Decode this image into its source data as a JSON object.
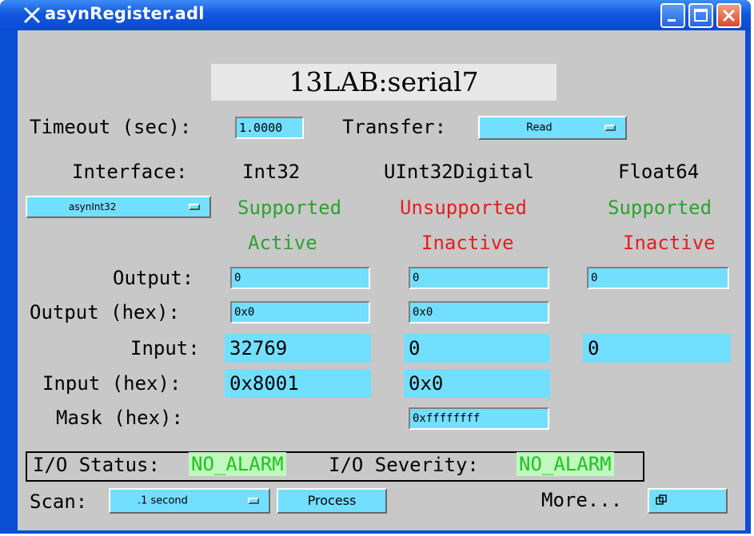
{
  "window": {
    "title": "asynRegister.adl"
  },
  "header": {
    "device": "13LAB:serial7"
  },
  "timeout": {
    "label": "Timeout (sec):",
    "value": "1.0000"
  },
  "transfer": {
    "label": "Transfer:",
    "value": "Read"
  },
  "interface": {
    "label": "Interface:",
    "selected": "asynInt32",
    "columns": [
      {
        "name": "Int32",
        "support": "Supported",
        "state": "Active"
      },
      {
        "name": "UInt32Digital",
        "support": "Unsupported",
        "state": "Inactive"
      },
      {
        "name": "Float64",
        "support": "Supported",
        "state": "Inactive"
      }
    ]
  },
  "rows": {
    "output": {
      "label": "Output:",
      "int32": "0",
      "uint32": "0",
      "float64": "0"
    },
    "output_hex": {
      "label": "Output (hex):",
      "int32": "0x0",
      "uint32": "0x0"
    },
    "input": {
      "label": "Input:",
      "int32": "32769",
      "uint32": "0",
      "float64": "0"
    },
    "input_hex": {
      "label": "Input (hex):",
      "int32": "0x8001",
      "uint32": "0x0"
    },
    "mask_hex": {
      "label": "Mask (hex):",
      "uint32": "0xffffffff"
    }
  },
  "status": {
    "io_status_label": "I/O Status:",
    "io_status_value": "NO_ALARM",
    "io_severity_label": "I/O Severity:",
    "io_severity_value": "NO_ALARM"
  },
  "footer": {
    "scan_label": "Scan:",
    "scan_value": ".1 second",
    "process_label": "Process",
    "more_label": "More..."
  },
  "colors": {
    "titlebar": "#0a4fd6",
    "panel": "#c8c8c8",
    "field": "#73dfff",
    "supported": "#2da22d",
    "unsupported": "#e0201e",
    "alarm_ok": "#21c221"
  }
}
